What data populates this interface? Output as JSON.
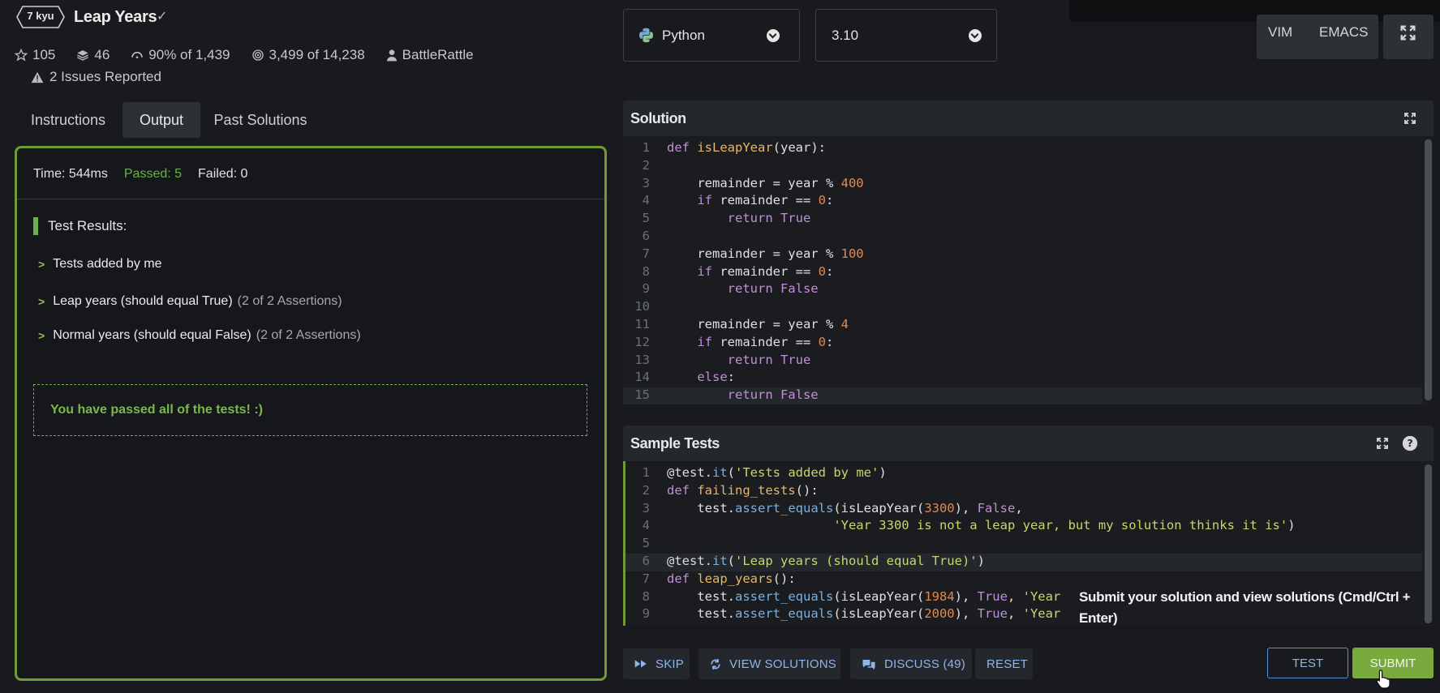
{
  "kata": {
    "rank": "7 kyu",
    "title": "Leap Years",
    "stars": "105",
    "collections": "46",
    "satisfaction": "90% of 1,439",
    "completions": "3,499 of 14,238",
    "author": "BattleRattle",
    "issues": "2 Issues Reported"
  },
  "tabs": [
    {
      "label": "Instructions"
    },
    {
      "label": "Output",
      "active": true
    },
    {
      "label": "Past Solutions"
    }
  ],
  "output": {
    "time": "Time: 544ms",
    "passed": "Passed: 5",
    "failed": "Failed: 0",
    "results_heading": "Test Results:",
    "groups": [
      {
        "label": "Tests added by me",
        "assertions": ""
      },
      {
        "label": "Leap years (should equal True)",
        "assertions": "(2 of 2 Assertions)"
      },
      {
        "label": "Normal years (should equal False)",
        "assertions": "(2 of 2 Assertions)"
      }
    ],
    "pass_message": "You have passed all of the tests! :)"
  },
  "language": {
    "selected": "Python",
    "version": "3.10"
  },
  "modes": {
    "vim": "VIM",
    "emacs": "EMACS"
  },
  "solution_panel": {
    "title": "Solution"
  },
  "sample_panel": {
    "title": "Sample Tests"
  },
  "tooltip": "Submit your solution and view solutions (Cmd/Ctrl + Enter)",
  "actions": {
    "skip": "SKIP",
    "view_solutions": "VIEW SOLUTIONS",
    "discuss": "DISCUSS (49)",
    "reset": "RESET",
    "test": "TEST",
    "submit": "SUBMIT"
  },
  "solution_lines": [
    [
      [
        "kw",
        "def "
      ],
      [
        "fn",
        "isLeapYear"
      ],
      [
        "",
        "(year):"
      ]
    ],
    [],
    [
      [
        "",
        "    remainder = year % "
      ],
      [
        "num",
        "400"
      ]
    ],
    [
      [
        "kw",
        "    if "
      ],
      [
        "",
        "remainder == "
      ],
      [
        "num",
        "0"
      ],
      [
        "",
        ":"
      ]
    ],
    [
      [
        "kw",
        "        return True"
      ]
    ],
    [],
    [
      [
        "",
        "    remainder = year % "
      ],
      [
        "num",
        "100"
      ]
    ],
    [
      [
        "kw",
        "    if "
      ],
      [
        "",
        "remainder == "
      ],
      [
        "num",
        "0"
      ],
      [
        "",
        ":"
      ]
    ],
    [
      [
        "kw",
        "        return False"
      ]
    ],
    [],
    [
      [
        "",
        "    remainder = year % "
      ],
      [
        "num",
        "4"
      ]
    ],
    [
      [
        "kw",
        "    if "
      ],
      [
        "",
        "remainder == "
      ],
      [
        "num",
        "0"
      ],
      [
        "",
        ":"
      ]
    ],
    [
      [
        "kw",
        "        return True"
      ]
    ],
    [
      [
        "kw",
        "    else"
      ],
      [
        "",
        ":"
      ]
    ],
    [
      [
        "kw",
        "        return False"
      ]
    ]
  ],
  "sample_lines": [
    [
      [
        "deco",
        "@test."
      ],
      [
        "meth",
        "it"
      ],
      [
        "",
        "("
      ],
      [
        "str",
        "'Tests added by me'"
      ],
      [
        "",
        ")"
      ]
    ],
    [
      [
        "kw",
        "def "
      ],
      [
        "fn",
        "failing_tests"
      ],
      [
        "",
        "():"
      ]
    ],
    [
      [
        "",
        "    test."
      ],
      [
        "meth",
        "assert_equals"
      ],
      [
        "",
        "(isLeapYear("
      ],
      [
        "num",
        "3300"
      ],
      [
        "",
        "), "
      ],
      [
        "kw",
        "False"
      ],
      [
        "",
        ","
      ]
    ],
    [
      [
        "",
        "                      "
      ],
      [
        "str",
        "'Year 3300 is not a leap year, but my solution thinks it is'"
      ],
      [
        "",
        ")"
      ]
    ],
    [],
    [
      [
        "deco",
        "@test."
      ],
      [
        "meth",
        "it"
      ],
      [
        "",
        "("
      ],
      [
        "str",
        "'Leap years (should equal True)'"
      ],
      [
        "",
        ")"
      ]
    ],
    [
      [
        "kw",
        "def "
      ],
      [
        "fn",
        "leap_years"
      ],
      [
        "",
        "():"
      ]
    ],
    [
      [
        "",
        "    test."
      ],
      [
        "meth",
        "assert_equals"
      ],
      [
        "",
        "(isLeapYear("
      ],
      [
        "num",
        "1984"
      ],
      [
        "",
        "), "
      ],
      [
        "kw",
        "True"
      ],
      [
        "",
        ", "
      ],
      [
        "str",
        "'Year"
      ]
    ],
    [
      [
        "",
        "    test."
      ],
      [
        "meth",
        "assert_equals"
      ],
      [
        "",
        "(isLeapYear("
      ],
      [
        "num",
        "2000"
      ],
      [
        "",
        "), "
      ],
      [
        "kw",
        "True"
      ],
      [
        "",
        ", "
      ],
      [
        "str",
        "'Year"
      ]
    ]
  ]
}
